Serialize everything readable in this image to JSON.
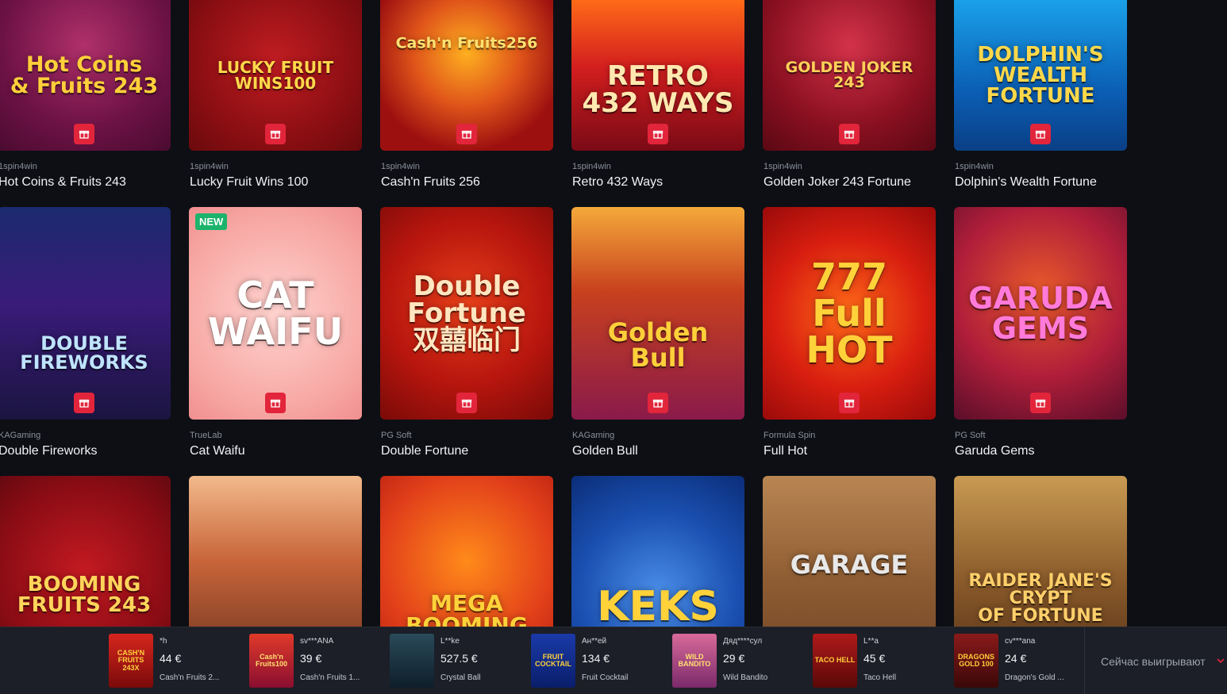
{
  "games": [
    {
      "provider": "1spin4win",
      "name": "Hot Coins & Fruits 243",
      "art": "Hot Coins\n& Fruits 243",
      "art_color": "#ffcf3a"
    },
    {
      "provider": "1spin4win",
      "name": "Lucky Fruit Wins 100",
      "art": "LUCKY FRUIT\nWINS100",
      "art_color": "#ffd84a"
    },
    {
      "provider": "1spin4win",
      "name": "Cash'n Fruits 256",
      "art": "Cash'n Fruits256",
      "art_color": "#ffe070"
    },
    {
      "provider": "1spin4win",
      "name": "Retro 432 Ways",
      "art": "RETRO\n432 WAYS",
      "art_color": "#ffe9b0"
    },
    {
      "provider": "1spin4win",
      "name": "Golden Joker 243 Fortune",
      "art": "GOLDEN JOKER 243",
      "art_color": "#ffd25a"
    },
    {
      "provider": "1spin4win",
      "name": "Dolphin's Wealth Fortune",
      "art": "DOLPHIN'S\nWEALTH\nFORTUNE",
      "art_color": "#ffd84a"
    },
    {
      "provider": "KAGaming",
      "name": "Double Fireworks",
      "art": "DOUBLE\nFIREWORKS",
      "art_color": "#bfe4ff"
    },
    {
      "provider": "TrueLab",
      "name": "Cat Waifu",
      "art": "CAT\nWAIFU",
      "art_color": "#ffffff",
      "badge": "NEW"
    },
    {
      "provider": "PG Soft",
      "name": "Double Fortune",
      "art": "Double\nFortune\n双囍临门",
      "art_color": "#ffe6c0"
    },
    {
      "provider": "KAGaming",
      "name": "Golden Bull",
      "art": "Golden Bull",
      "art_color": "#ffcf3a"
    },
    {
      "provider": "Formula Spin",
      "name": "Full Hot",
      "art": "777\nFull\nHOT",
      "art_color": "#ffd23a"
    },
    {
      "provider": "PG Soft",
      "name": "Garuda Gems",
      "art": "GARUDA\nGEMS",
      "art_color": "#ff7ad9"
    },
    {
      "provider": "",
      "name": "",
      "art": "BOOMING\nFRUITS 243",
      "art_color": "#ffd45a"
    },
    {
      "provider": "",
      "name": "",
      "art": "",
      "art_color": "#ffffff"
    },
    {
      "provider": "",
      "name": "",
      "art": "MEGA BOOMING",
      "art_color": "#ffd23a"
    },
    {
      "provider": "",
      "name": "",
      "art": "KEKS",
      "art_color": "#ffd23a"
    },
    {
      "provider": "",
      "name": "",
      "art": "GARAGE",
      "art_color": "#e8e8e8"
    },
    {
      "provider": "",
      "name": "",
      "art": "RAIDER JANE'S\nCRYPT\nOF FORTUNE",
      "art_color": "#ffcf6a"
    }
  ],
  "winners": [
    {
      "user": "*h",
      "amount": "44 €",
      "game": "Cash'n Fruits 2...",
      "thumb": "CASH'N\nFRUITS 243X"
    },
    {
      "user": "sv***ANA",
      "amount": "39 €",
      "game": "Cash'n Fruits 1...",
      "thumb": "Cash'n\nFruits100"
    },
    {
      "user": "L**ke",
      "amount": "527.5 €",
      "game": "Crystal Ball",
      "thumb": ""
    },
    {
      "user": "Ан**ей",
      "amount": "134 €",
      "game": "Fruit Cocktail",
      "thumb": "FRUIT\nCOCKTAIL"
    },
    {
      "user": "Дяд****сул",
      "amount": "29 €",
      "game": "Wild Bandito",
      "thumb": "WILD\nBANDITO"
    },
    {
      "user": "L**a",
      "amount": "45 €",
      "game": "Taco Hell",
      "thumb": "TACO HELL"
    },
    {
      "user": "cv***ana",
      "amount": "24 €",
      "game": "Dragon's Gold ...",
      "thumb": "DRAGONS\nGOLD 100"
    }
  ],
  "ticker_label": "Сейчас выигрывают",
  "colors": {
    "accent": "#e2253b",
    "new_badge": "#1cb36b",
    "background": "#0d0f14"
  }
}
